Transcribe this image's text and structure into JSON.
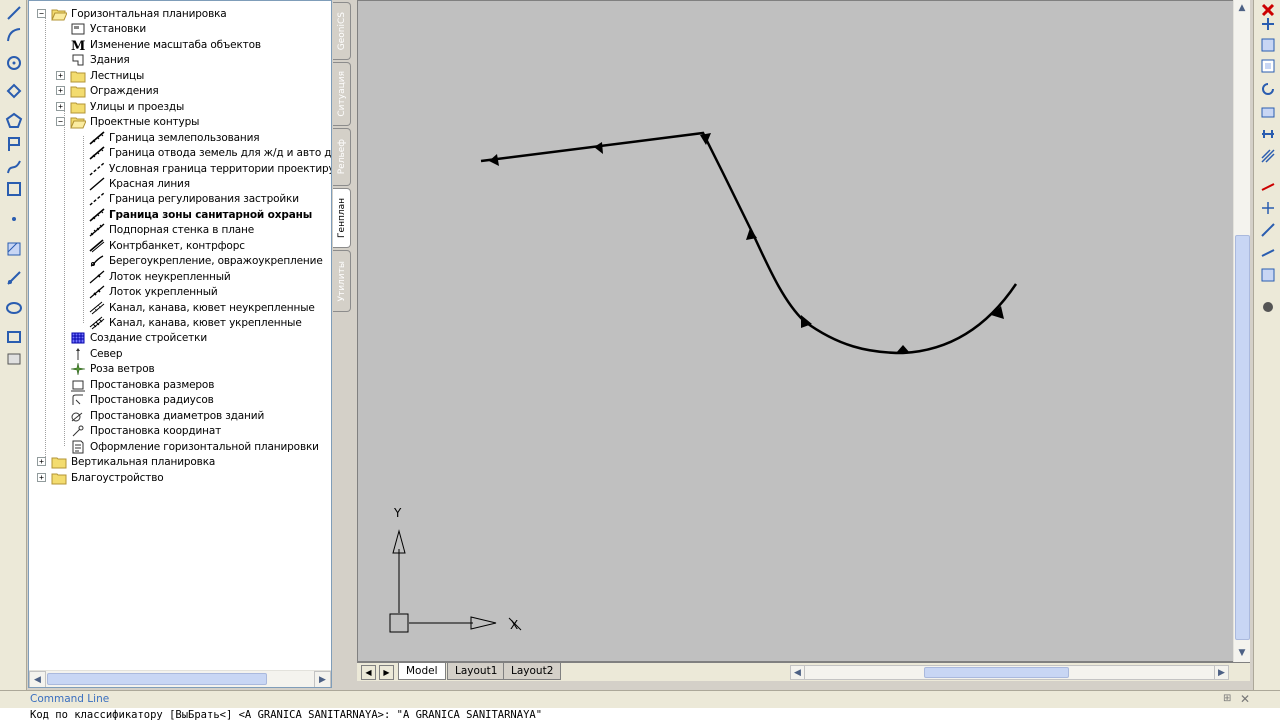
{
  "tree": {
    "items": [
      {
        "label": "Горизонтальная планировка",
        "level": 0,
        "expander": "−",
        "icon": "folder-open-icon"
      },
      {
        "label": "Установки",
        "level": 1,
        "icon": "settings-dialog-icon"
      },
      {
        "label": "Изменение масштаба объектов",
        "level": 1,
        "icon": "m-scale-icon"
      },
      {
        "label": "Здания",
        "level": 1,
        "icon": "building-icon"
      },
      {
        "label": "Лестницы",
        "level": 1,
        "expander": "+",
        "icon": "folder-icon"
      },
      {
        "label": "Ограждения",
        "level": 1,
        "expander": "+",
        "icon": "folder-icon"
      },
      {
        "label": "Улицы и проезды",
        "level": 1,
        "expander": "+",
        "icon": "folder-icon"
      },
      {
        "label": "Проектные контуры",
        "level": 1,
        "expander": "−",
        "icon": "folder-open-icon"
      },
      {
        "label": "Граница землепользования",
        "level": 2,
        "icon": "boundary-line-icon"
      },
      {
        "label": "Граница отвода земель для ж/д и авто дор",
        "level": 2,
        "icon": "boundary-line-icon"
      },
      {
        "label": "Условная граница территории проектируе",
        "level": 2,
        "icon": "dashed-line-icon"
      },
      {
        "label": "Красная линия",
        "level": 2,
        "icon": "line-icon"
      },
      {
        "label": "Граница регулирования застройки",
        "level": 2,
        "icon": "dashed-line-icon"
      },
      {
        "label": "Граница зоны санитарной охраны",
        "level": 2,
        "icon": "boundary-line-icon",
        "bold": true
      },
      {
        "label": "Подпорная стенка в плане",
        "level": 2,
        "icon": "retaining-wall-icon"
      },
      {
        "label": "Контрбанкет, контрфорс",
        "level": 2,
        "icon": "double-line-icon"
      },
      {
        "label": "Берегоукрепление, овражоукрепление",
        "level": 2,
        "icon": "shore-icon"
      },
      {
        "label": "Лоток неукрепленный",
        "level": 2,
        "icon": "tray-icon"
      },
      {
        "label": "Лоток укрепленный",
        "level": 2,
        "icon": "tray-reinforced-icon"
      },
      {
        "label": "Канал, канава, кювет неукрепленные",
        "level": 2,
        "icon": "channel-icon"
      },
      {
        "label": "Канал, канава, кювет укрепленные",
        "level": 2,
        "icon": "channel-reinforced-icon"
      },
      {
        "label": "Создание стройсетки",
        "level": 1,
        "icon": "grid-icon"
      },
      {
        "label": "Север",
        "level": 1,
        "icon": "north-arrow-icon"
      },
      {
        "label": "Роза ветров",
        "level": 1,
        "icon": "wind-rose-icon"
      },
      {
        "label": "Простановка размеров",
        "level": 1,
        "icon": "dimension-icon"
      },
      {
        "label": "Простановка радиусов",
        "level": 1,
        "icon": "radius-icon"
      },
      {
        "label": "Простановка диаметров зданий",
        "level": 1,
        "icon": "diameter-icon"
      },
      {
        "label": "Простановка координат",
        "level": 1,
        "icon": "coordinate-icon"
      },
      {
        "label": "Оформление горизонтальной планировки",
        "level": 1,
        "icon": "document-icon"
      },
      {
        "label": "Вертикальная планировка",
        "level": 0,
        "expander": "+",
        "icon": "folder-icon"
      },
      {
        "label": "Благоустройство",
        "level": 0,
        "expander": "+",
        "icon": "folder-icon"
      }
    ]
  },
  "side_tabs": [
    {
      "label": "GeoniCS",
      "active": false
    },
    {
      "label": "Ситуация",
      "active": false
    },
    {
      "label": "Рельеф",
      "active": false
    },
    {
      "label": "Генплан",
      "active": true
    },
    {
      "label": "Утилиты",
      "active": false
    }
  ],
  "layout_tabs": [
    "Model",
    "Layout1",
    "Layout2"
  ],
  "ucs": {
    "x_label": "X",
    "y_label": "Y"
  },
  "command_line": {
    "title": "Command Line",
    "text": "Код по классификатору [ВыБрать<] <A_GRANICA_SANITARNAYA>:  \"A_GRANICA_SANITARNAYA\""
  },
  "colors": {
    "drawing_bg": "#c0c0c0",
    "contour": "#000000",
    "active_tab": "#ffffff",
    "close_icon": "#cc0000"
  }
}
